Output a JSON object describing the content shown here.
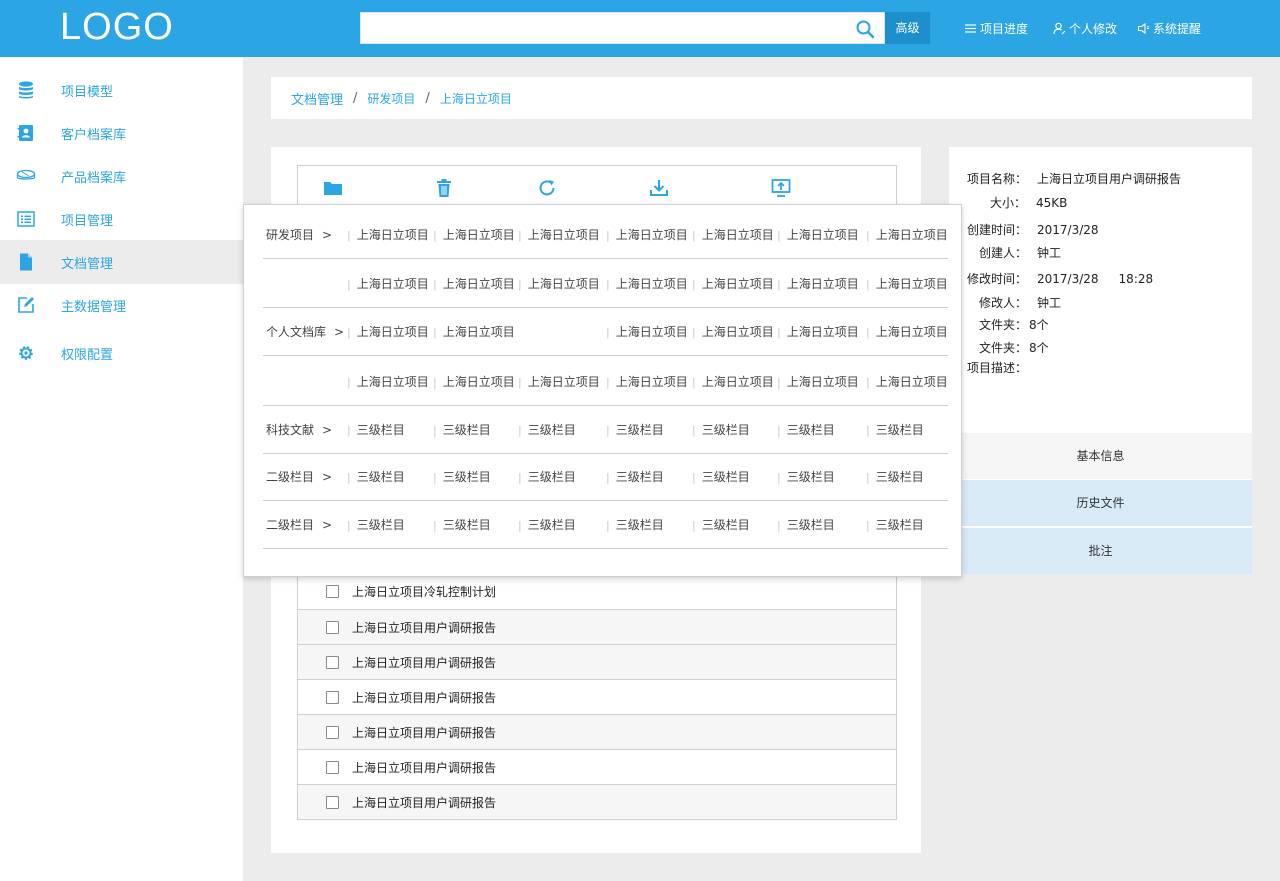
{
  "header": {
    "logo": "LOGO",
    "search_placeholder": "",
    "advanced_label": "高级",
    "nav": [
      {
        "label": "项目进度",
        "icon": "list-icon"
      },
      {
        "label": "个人修改",
        "icon": "user-edit-icon"
      },
      {
        "label": "系统提醒",
        "icon": "speaker-icon"
      }
    ]
  },
  "sidebar": {
    "items": [
      {
        "label": "项目模型",
        "icon": "database-icon"
      },
      {
        "label": "客户档案库",
        "icon": "contact-book-icon"
      },
      {
        "label": "产品档案库",
        "icon": "product-icon"
      },
      {
        "label": "项目管理",
        "icon": "list-icon"
      },
      {
        "label": "文档管理",
        "icon": "document-icon",
        "active": true
      },
      {
        "label": "主数据管理",
        "icon": "edit-icon"
      },
      {
        "label": "权限配置",
        "icon": "gear-icon"
      }
    ]
  },
  "breadcrumb": [
    "文档管理",
    "研发项目",
    "上海日立项目"
  ],
  "toolbar": {
    "icons": [
      "folder-icon",
      "trash-icon",
      "refresh-icon",
      "download-icon",
      "upload-icon"
    ]
  },
  "files": [
    "上海日立项目冷轧控制计划",
    "上海日立项目用户调研报告",
    "上海日立项目用户调研报告",
    "上海日立项目用户调研报告",
    "上海日立项目用户调研报告",
    "上海日立项目用户调研报告",
    "上海日立项目用户调研报告"
  ],
  "info": {
    "name_label": "项目名称：",
    "name_value": "上海日立项目用户调研报告",
    "size_label": "大小：",
    "size_value": "45KB",
    "created_label": "创建时间：",
    "created_value": "2017/3/28",
    "creator_label": "创建人：",
    "creator_value": "钟工",
    "modified_label": "修改时间：",
    "modified_date": "2017/3/28",
    "modified_time": "18:28",
    "modifier_label": "修改人：",
    "modifier_value": "钟工",
    "folder1_label": "文件夹：",
    "folder1_value": "8个",
    "folder2_label": "文件夹：",
    "folder2_value": "8个",
    "desc_label": "项目描述：",
    "tabs": [
      "基本信息",
      "历史文件",
      "批注"
    ]
  },
  "dropdown": {
    "rows": [
      {
        "category": "研发项目",
        "arrow": ">",
        "cells": [
          "上海日立项目",
          "上海日立项目",
          "上海日立项目",
          "上海日立项目",
          "上海日立项目",
          "上海日立项目",
          "上海日立项目"
        ]
      },
      {
        "category": "",
        "arrow": "",
        "cells": [
          "上海日立项目",
          "上海日立项目",
          "上海日立项目",
          "上海日立项目",
          "上海日立项目",
          "上海日立项目",
          "上海日立项目"
        ]
      },
      {
        "category": "个人文档库",
        "arrow": ">",
        "cells": [
          "上海日立项目",
          "上海日立项目",
          "",
          "上海日立项目",
          "上海日立项目",
          "上海日立项目",
          "上海日立项目"
        ]
      },
      {
        "category": "",
        "arrow": "",
        "cells": [
          "上海日立项目",
          "上海日立项目",
          "上海日立项目",
          "上海日立项目",
          "上海日立项目",
          "上海日立项目",
          "上海日立项目"
        ]
      },
      {
        "category": "科技文献",
        "arrow": ">",
        "cells": [
          "三级栏目",
          "三级栏目",
          "三级栏目",
          "三级栏目",
          "三级栏目",
          "三级栏目",
          "三级栏目"
        ]
      },
      {
        "category": "二级栏目",
        "arrow": ">",
        "cells": [
          "三级栏目",
          "三级栏目",
          "三级栏目",
          "三级栏目",
          "三级栏目",
          "三级栏目",
          "三级栏目"
        ]
      },
      {
        "category": "二级栏目",
        "arrow": ">",
        "cells": [
          "三级栏目",
          "三级栏目",
          "三级栏目",
          "三级栏目",
          "三级栏目",
          "三级栏目",
          "三级栏目"
        ]
      }
    ]
  },
  "colors": {
    "brand": "#2ba5e4",
    "tab_active": "#d7eaf6"
  }
}
